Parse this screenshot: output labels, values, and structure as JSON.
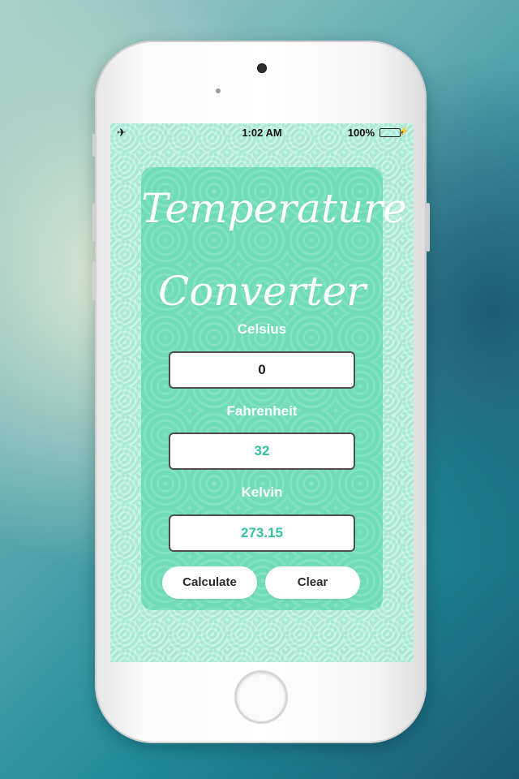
{
  "status_bar": {
    "airplane_icon": "✈",
    "time": "1:02 AM",
    "battery_percent": "100%",
    "battery_fill": 1.0,
    "charging_icon": "⚡"
  },
  "app": {
    "title_line1": "Temperature",
    "title_line2": "Converter",
    "celsius_label": "Celsius",
    "celsius_value": "0",
    "fahrenheit_label": "Fahrenheit",
    "fahrenheit_value": "32",
    "kelvin_label": "Kelvin",
    "kelvin_value": "273.15",
    "calculate_label": "Calculate",
    "clear_label": "Clear"
  },
  "colors": {
    "background_mint": "#a8ead6",
    "card": "#6fdcb7",
    "result_text": "#33c0a0",
    "battery_green": "#3ccf4e"
  }
}
